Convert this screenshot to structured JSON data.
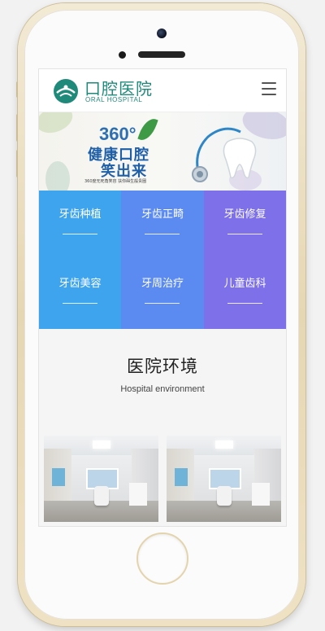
{
  "header": {
    "logo_cn": "口腔医院",
    "logo_en": "ORAL HOSPITAL",
    "menu_icon": "hamburger-menu-icon"
  },
  "banner": {
    "headline_num": "360°",
    "line1": "健康口腔",
    "line2": "笑出来",
    "subtitle": "360度无死角笑容 扶你碍生般贵圈"
  },
  "services": [
    {
      "label": "牙齿种植"
    },
    {
      "label": "牙齿正畸"
    },
    {
      "label": "牙齿修复"
    },
    {
      "label": "牙齿美容"
    },
    {
      "label": "牙周治疗"
    },
    {
      "label": "儿童齿科"
    }
  ],
  "environment": {
    "title": "医院环境",
    "subtitle": "Hospital environment"
  },
  "colors": {
    "brand": "#1f8a7a",
    "blue": "#3fa4ee",
    "indigo": "#5b8bf1",
    "purple": "#7d70e9"
  }
}
